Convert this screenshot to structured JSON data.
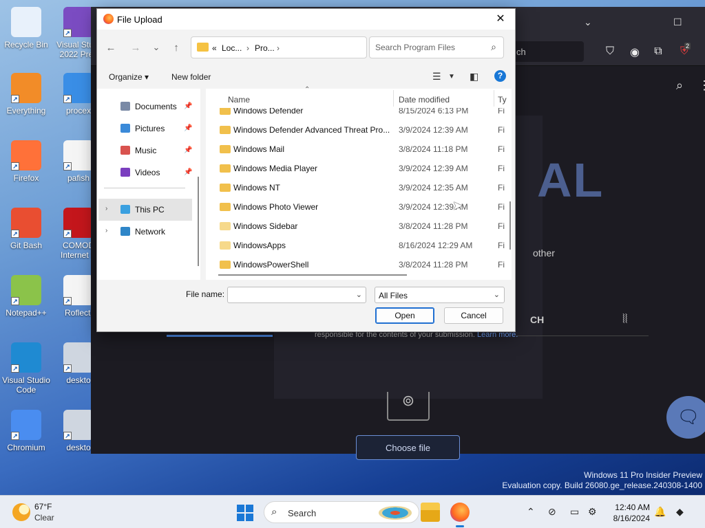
{
  "desktop": {
    "icons": [
      {
        "label": "Recycle Bin",
        "icon": "recycle-bin-icon",
        "color": "#e8f1fb"
      },
      {
        "label": "Visual Stu... 2022 Prev",
        "icon": "visual-studio-icon",
        "color": "#7b4cc2"
      },
      {
        "label": "Everything",
        "icon": "everything-icon",
        "color": "#f28c28"
      },
      {
        "label": "procex",
        "icon": "procexp-icon",
        "color": "#3a8ee6"
      },
      {
        "label": "Firefox",
        "icon": "firefox-icon",
        "color": "#ff7139"
      },
      {
        "label": "pafish",
        "icon": "file-icon",
        "color": "#f5f5f5"
      },
      {
        "label": "Git Bash",
        "icon": "git-bash-icon",
        "color": "#e94e31"
      },
      {
        "label": "COMOD Internet S",
        "icon": "comodo-icon",
        "color": "#c4161c"
      },
      {
        "label": "Notepad++",
        "icon": "notepad-plus-plus-icon",
        "color": "#8bc34a"
      },
      {
        "label": "Roflecti",
        "icon": "file-icon",
        "color": "#f5f5f5"
      },
      {
        "label": "Visual Studio Code",
        "icon": "vscode-icon",
        "color": "#1f8ad2"
      },
      {
        "label": "deskto",
        "icon": "desktop-file-icon",
        "color": "#cfd6e0"
      },
      {
        "label": "Chromium",
        "icon": "chromium-icon",
        "color": "#4a8df0"
      },
      {
        "label": "deskto",
        "icon": "desktop-file-icon",
        "color": "#cfd6e0"
      }
    ],
    "watermark_line1": "Windows 11 Pro Insider Preview",
    "watermark_line2": "Evaluation copy. Build 26080.ge_release.240308-1400"
  },
  "browser": {
    "url_fragment": "ch",
    "ext_badge": "2",
    "big_text": "AL",
    "side_text": "other",
    "tab_label": "CH",
    "responsible_text": "responsible for the contents of your submission.",
    "learn_link": "Learn more.",
    "choose_file": "Choose file"
  },
  "dialog": {
    "title": "File Upload",
    "close": "✕",
    "nav": {
      "back": "←",
      "forward": "→",
      "recent": "⌄",
      "up": "↑"
    },
    "address": {
      "seg_prefix": "«",
      "seg1": "Loc...",
      "sep": "›",
      "seg2": "Pro...",
      "dropdown": "⌄",
      "refresh": "↻"
    },
    "search_placeholder": "Search Program Files",
    "toolbar": {
      "organize": "Organize ▾",
      "new_folder": "New folder",
      "help": "?"
    },
    "nav_pane": {
      "quick": [
        {
          "label": "Documents",
          "icon": "documents-icon",
          "color": "#7a8aa6"
        },
        {
          "label": "Pictures",
          "icon": "pictures-icon",
          "color": "#3b8ad9"
        },
        {
          "label": "Music",
          "icon": "music-icon",
          "color": "#d9534f"
        },
        {
          "label": "Videos",
          "icon": "videos-icon",
          "color": "#7b3fbf"
        }
      ],
      "this_pc": "This PC",
      "network": "Network"
    },
    "columns": {
      "name": "Name",
      "date": "Date modified",
      "type": "Ty"
    },
    "rows": [
      {
        "name": "Windows Defender",
        "date": "8/15/2024 6:13 PM",
        "type": "Fi"
      },
      {
        "name": "Windows Defender Advanced Threat Pro...",
        "date": "3/9/2024 12:39 AM",
        "type": "Fi"
      },
      {
        "name": "Windows Mail",
        "date": "3/8/2024 11:18 PM",
        "type": "Fi"
      },
      {
        "name": "Windows Media Player",
        "date": "3/9/2024 12:39 AM",
        "type": "Fi"
      },
      {
        "name": "Windows NT",
        "date": "3/9/2024 12:35 AM",
        "type": "Fi"
      },
      {
        "name": "Windows Photo Viewer",
        "date": "3/9/2024 12:39 AM",
        "type": "Fi"
      },
      {
        "name": "Windows Sidebar",
        "date": "3/8/2024 11:28 PM",
        "type": "Fi"
      },
      {
        "name": "WindowsApps",
        "date": "8/16/2024 12:29 AM",
        "type": "Fi"
      },
      {
        "name": "WindowsPowerShell",
        "date": "3/8/2024 11:28 PM",
        "type": "Fi"
      }
    ],
    "file_name_label": "File name:",
    "file_name_value": "",
    "file_type": "All Files",
    "open": "Open",
    "cancel": "Cancel"
  },
  "taskbar": {
    "temp": "67°F",
    "condition": "Clear",
    "search": "Search",
    "time": "12:40 AM",
    "date": "8/16/2024"
  }
}
